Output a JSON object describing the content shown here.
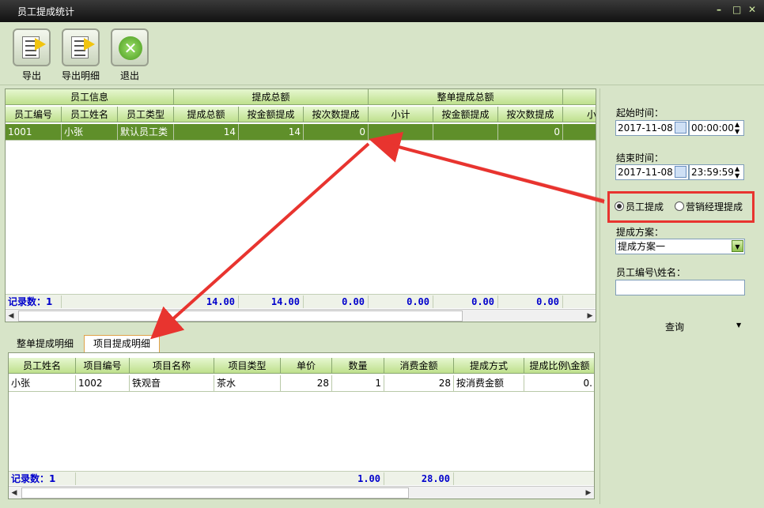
{
  "window": {
    "title": "员工提成统计",
    "controls": [
      "–",
      "□",
      "✕"
    ]
  },
  "toolbar": {
    "export": "导出",
    "export_detail": "导出明细",
    "exit": "退出"
  },
  "top_grid": {
    "group_headers": [
      "员工信息",
      "提成总额",
      "整单提成总额"
    ],
    "columns": [
      "员工编号",
      "员工姓名",
      "员工类型",
      "提成总额",
      "按金额提成",
      "按次数提成",
      "小计",
      "按金额提成",
      "按次数提成",
      "小"
    ],
    "rows": [
      [
        "1001",
        "小张",
        "默认员工类",
        "14",
        "14",
        "0",
        "",
        "",
        "0",
        ""
      ]
    ],
    "footer": {
      "label": "记录数：1",
      "values": [
        "14.00",
        "14.00",
        "0.00",
        "0.00",
        "0.00",
        "0.00"
      ]
    }
  },
  "tabs": [
    "整单提成明细",
    "项目提成明细"
  ],
  "detail_grid": {
    "columns": [
      "员工姓名",
      "项目编号",
      "项目名称",
      "项目类型",
      "单价",
      "数量",
      "消费金额",
      "提成方式",
      "提成比例\\金额"
    ],
    "rows": [
      [
        "小张",
        "1002",
        "铁观音",
        "茶水",
        "28",
        "1",
        "28",
        "按消费金额",
        "0."
      ]
    ],
    "footer": {
      "label": "记录数：1",
      "qty": "1.00",
      "amount": "28.00"
    }
  },
  "filter": {
    "start_label": "起始时间：",
    "start_date": "2017-11-08",
    "start_time": "00:00:00",
    "end_label": "结束时间：",
    "end_date": "2017-11-08",
    "end_time": "23:59:59",
    "radio_employee": "员工提成",
    "radio_manager": "营销经理提成",
    "plan_label": "提成方案：",
    "plan_value": "提成方案一",
    "id_label": "员工编号\\姓名：",
    "id_value": "",
    "query": "查询"
  },
  "colors": {
    "accent_green": "#5f8f2a",
    "highlight_red": "#e8342f"
  }
}
